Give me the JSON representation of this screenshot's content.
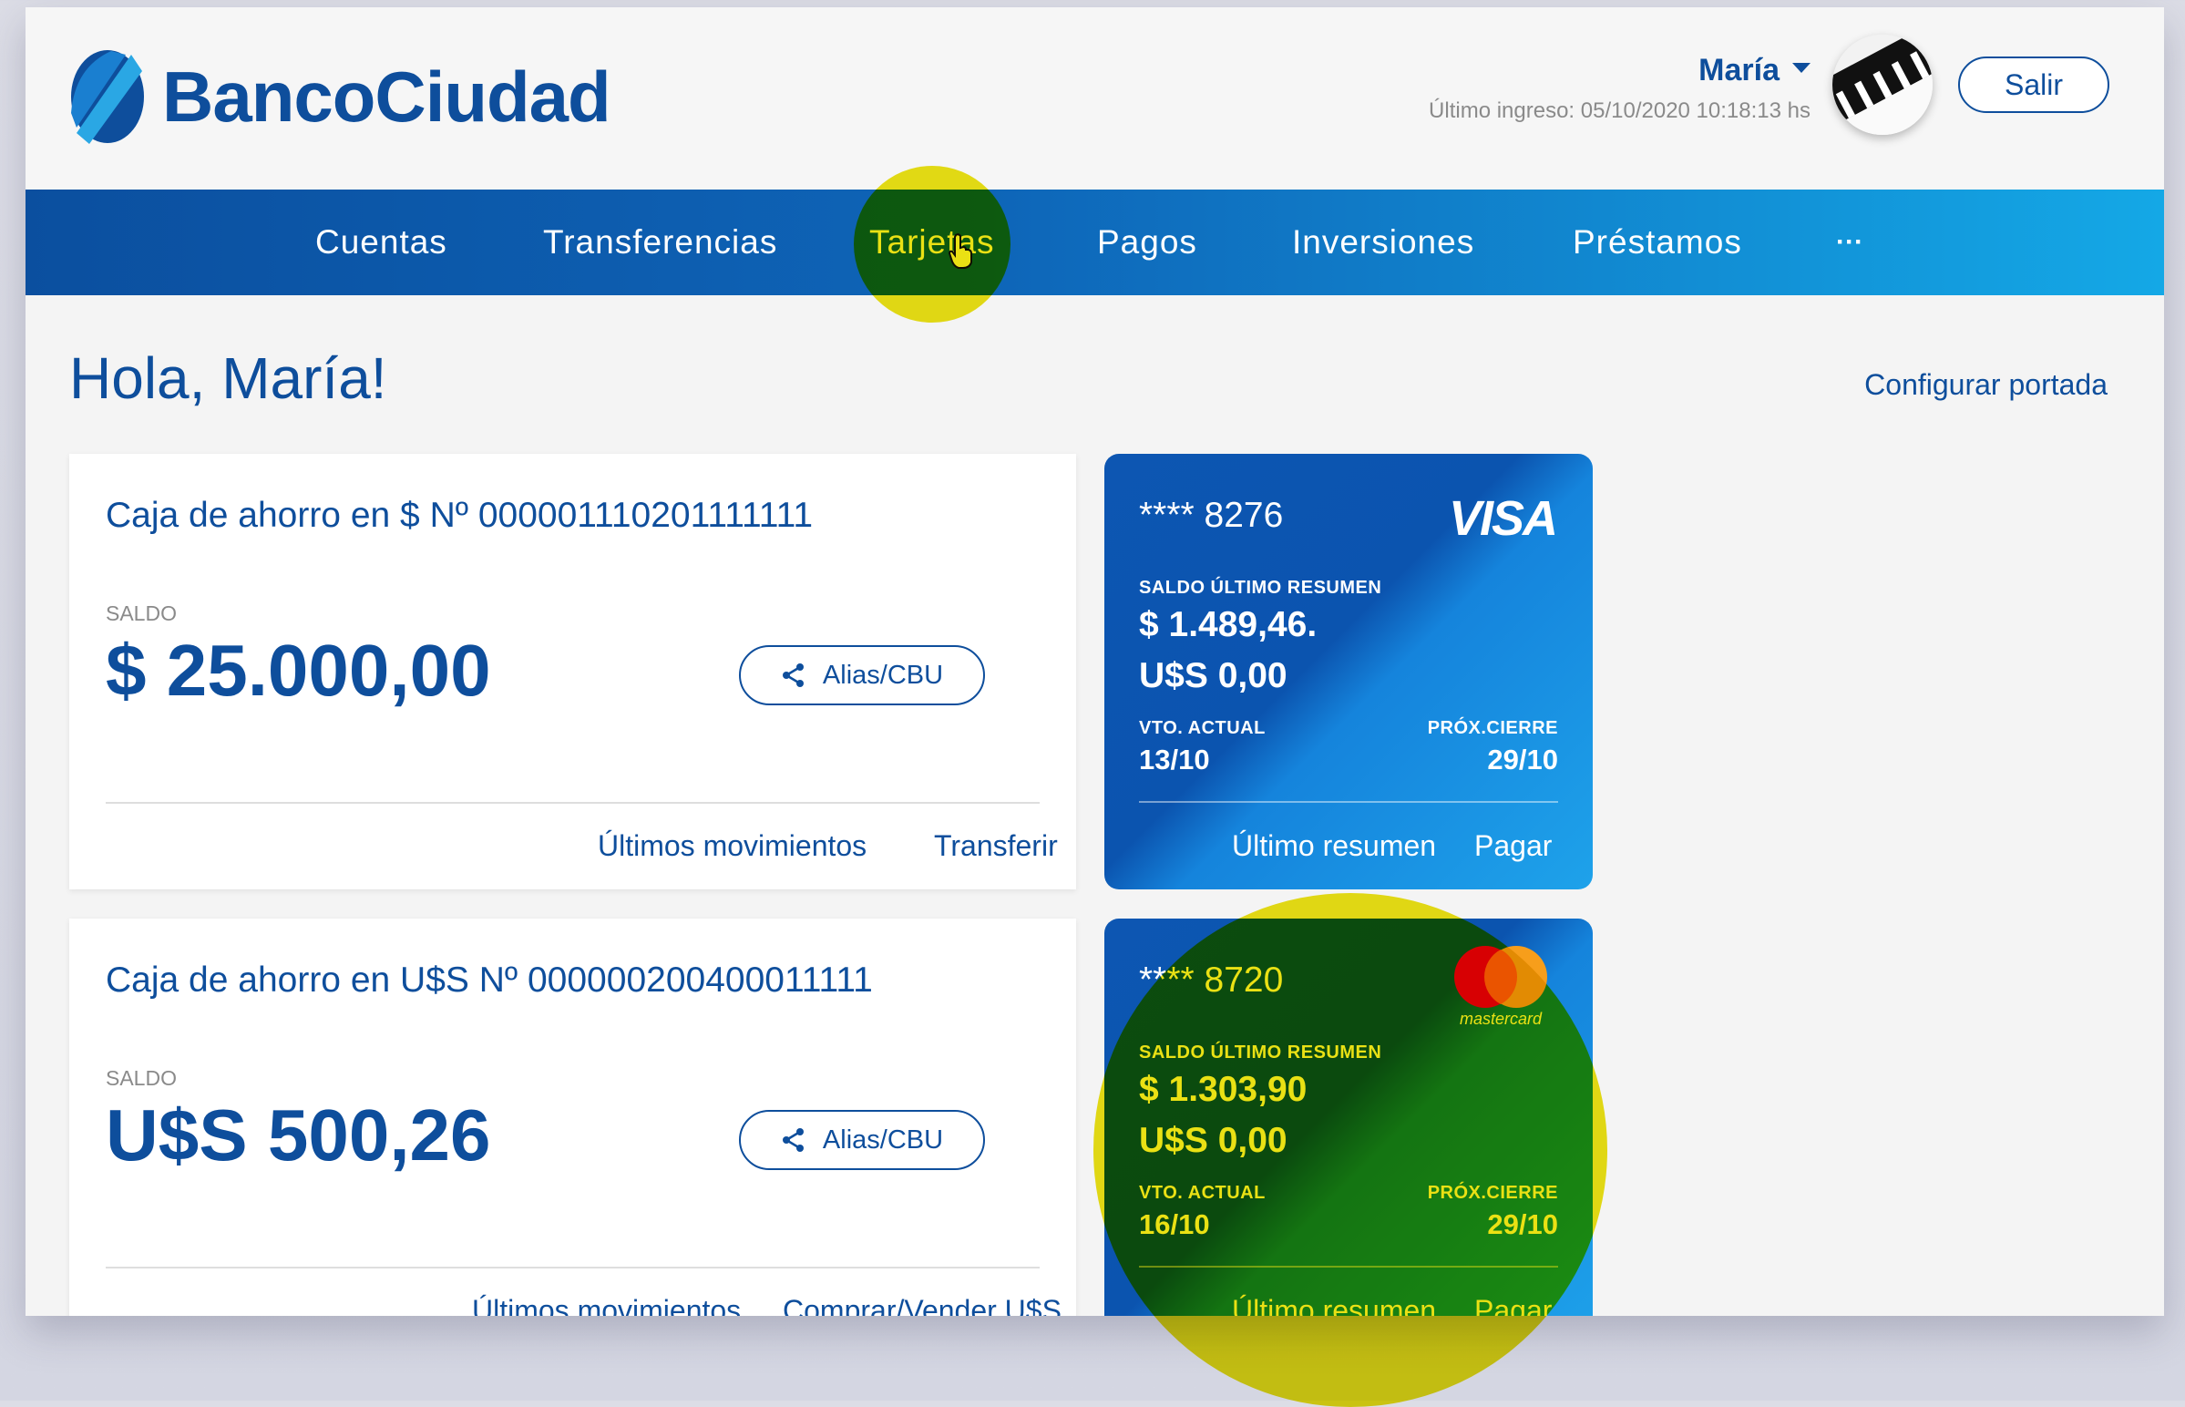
{
  "header": {
    "brand": "BancoCiudad",
    "user_name": "María",
    "last_login": "Último ingreso: 05/10/2020 10:18:13 hs",
    "logout_label": "Salir"
  },
  "nav": {
    "items": [
      {
        "label": "Cuentas"
      },
      {
        "label": "Transferencias"
      },
      {
        "label": "Tarjetas"
      },
      {
        "label": "Pagos"
      },
      {
        "label": "Inversiones"
      },
      {
        "label": "Préstamos"
      },
      {
        "label": "···"
      }
    ],
    "highlighted": "Tarjetas"
  },
  "main": {
    "greeting": "Hola, María!",
    "configure_label": "Configurar portada",
    "accounts": [
      {
        "title": "Caja de ahorro en $ Nº 000001110201111111",
        "balance_label": "SALDO",
        "balance": "$ 25.000,00",
        "alias_label": "Alias/CBU",
        "link_movements": "Últimos movimientos",
        "link_action": "Transferir"
      },
      {
        "title": "Caja de ahorro en U$S Nº 000000200400011111",
        "balance_label": "SALDO",
        "balance": "U$S 500,26",
        "alias_label": "Alias/CBU",
        "link_movements": "Últimos movimientos",
        "link_action": "Comprar/Vender U$S"
      }
    ],
    "cards": [
      {
        "number": "**** 8276",
        "brand": "VISA",
        "summary_label": "SALDO ÚLTIMO RESUMEN",
        "amount_ars": "$ 1.489,46.",
        "amount_usd": "U$S 0,00",
        "due_label": "VTO. ACTUAL",
        "due_value": "13/10",
        "close_label": "PRÓX.CIERRE",
        "close_value": "29/10",
        "link_summary": "Último resumen",
        "link_pay": "Pagar"
      },
      {
        "number": "**** 8720",
        "brand": "mastercard",
        "summary_label": "SALDO ÚLTIMO RESUMEN",
        "amount_ars": "$ 1.303,90",
        "amount_usd": "U$S 0,00",
        "due_label": "VTO. ACTUAL",
        "due_value": "16/10",
        "close_label": "PRÓX.CIERRE",
        "close_value": "29/10",
        "link_summary": "Último resumen",
        "link_pay": "Pagar"
      }
    ]
  },
  "colors": {
    "brand_blue": "#0e4e9c",
    "highlight_yellow": "#e8de00"
  }
}
